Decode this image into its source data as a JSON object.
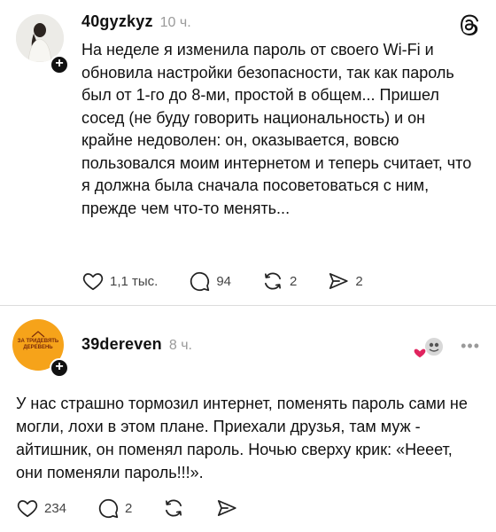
{
  "posts": [
    {
      "username": "40gyzkyz",
      "time": "10 ч.",
      "text": "На неделе я изменила пароль от своего Wi-Fi и обновила настройки безопасности, так как пароль был от 1-го до 8-ми, простой в общем... Пришел сосед (не буду говорить национальность) и он крайне недоволен: он, оказывается, вовсю пользовался моим интернетом и теперь считает, что я должна была сначала посоветоваться с ним, прежде чем что-то менять...",
      "likes": "1,1 тыс.",
      "replies": "94",
      "reposts": "2",
      "shares": "2"
    },
    {
      "username": "39dereven",
      "time": "8 ч.",
      "avatar_text": "ЗА ТРИДЕВЯТЬ ДЕРЕВЕНЬ",
      "text": "У нас страшно тормозил интернет, поменять пароль сами не могли, лохи в этом плане. Приехали друзья, там муж - айтишник, он поменял пароль. Ночью сверху крик: «Нееет, они поменяли пароль!!!».",
      "likes": "234",
      "replies": "2"
    }
  ],
  "icons": {
    "threads": "threads-logo-icon",
    "like": "heart-icon",
    "reply": "speech-bubble-icon",
    "repost": "repost-arrows-icon",
    "share": "send-icon",
    "more": "more-dots-icon"
  },
  "colors": {
    "avatar2_bg": "#f6a31a",
    "liked_heart": "#e0245e"
  }
}
